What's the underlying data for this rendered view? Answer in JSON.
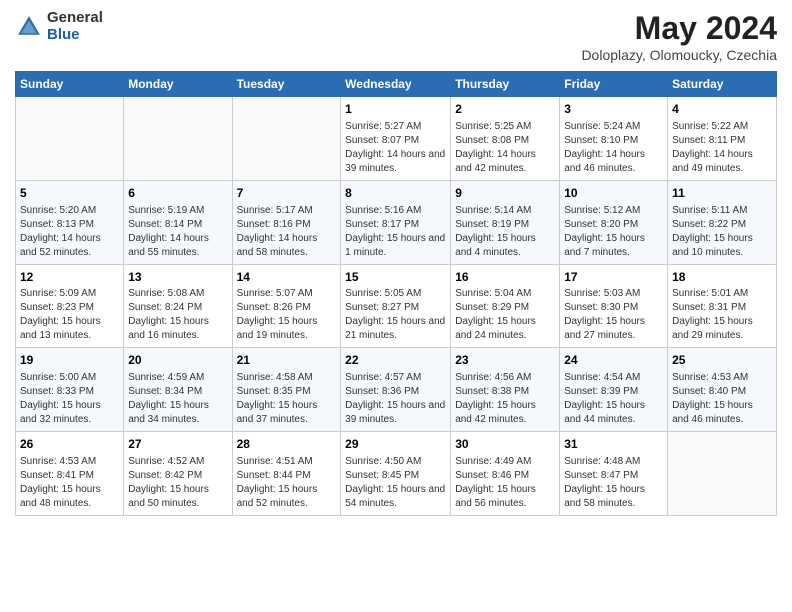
{
  "header": {
    "logo_general": "General",
    "logo_blue": "Blue",
    "month_title": "May 2024",
    "location": "Doloplazy, Olomoucky, Czechia"
  },
  "days_of_week": [
    "Sunday",
    "Monday",
    "Tuesday",
    "Wednesday",
    "Thursday",
    "Friday",
    "Saturday"
  ],
  "weeks": [
    [
      {
        "day": "",
        "info": ""
      },
      {
        "day": "",
        "info": ""
      },
      {
        "day": "",
        "info": ""
      },
      {
        "day": "1",
        "info": "Sunrise: 5:27 AM\nSunset: 8:07 PM\nDaylight: 14 hours and 39 minutes."
      },
      {
        "day": "2",
        "info": "Sunrise: 5:25 AM\nSunset: 8:08 PM\nDaylight: 14 hours and 42 minutes."
      },
      {
        "day": "3",
        "info": "Sunrise: 5:24 AM\nSunset: 8:10 PM\nDaylight: 14 hours and 46 minutes."
      },
      {
        "day": "4",
        "info": "Sunrise: 5:22 AM\nSunset: 8:11 PM\nDaylight: 14 hours and 49 minutes."
      }
    ],
    [
      {
        "day": "5",
        "info": "Sunrise: 5:20 AM\nSunset: 8:13 PM\nDaylight: 14 hours and 52 minutes."
      },
      {
        "day": "6",
        "info": "Sunrise: 5:19 AM\nSunset: 8:14 PM\nDaylight: 14 hours and 55 minutes."
      },
      {
        "day": "7",
        "info": "Sunrise: 5:17 AM\nSunset: 8:16 PM\nDaylight: 14 hours and 58 minutes."
      },
      {
        "day": "8",
        "info": "Sunrise: 5:16 AM\nSunset: 8:17 PM\nDaylight: 15 hours and 1 minute."
      },
      {
        "day": "9",
        "info": "Sunrise: 5:14 AM\nSunset: 8:19 PM\nDaylight: 15 hours and 4 minutes."
      },
      {
        "day": "10",
        "info": "Sunrise: 5:12 AM\nSunset: 8:20 PM\nDaylight: 15 hours and 7 minutes."
      },
      {
        "day": "11",
        "info": "Sunrise: 5:11 AM\nSunset: 8:22 PM\nDaylight: 15 hours and 10 minutes."
      }
    ],
    [
      {
        "day": "12",
        "info": "Sunrise: 5:09 AM\nSunset: 8:23 PM\nDaylight: 15 hours and 13 minutes."
      },
      {
        "day": "13",
        "info": "Sunrise: 5:08 AM\nSunset: 8:24 PM\nDaylight: 15 hours and 16 minutes."
      },
      {
        "day": "14",
        "info": "Sunrise: 5:07 AM\nSunset: 8:26 PM\nDaylight: 15 hours and 19 minutes."
      },
      {
        "day": "15",
        "info": "Sunrise: 5:05 AM\nSunset: 8:27 PM\nDaylight: 15 hours and 21 minutes."
      },
      {
        "day": "16",
        "info": "Sunrise: 5:04 AM\nSunset: 8:29 PM\nDaylight: 15 hours and 24 minutes."
      },
      {
        "day": "17",
        "info": "Sunrise: 5:03 AM\nSunset: 8:30 PM\nDaylight: 15 hours and 27 minutes."
      },
      {
        "day": "18",
        "info": "Sunrise: 5:01 AM\nSunset: 8:31 PM\nDaylight: 15 hours and 29 minutes."
      }
    ],
    [
      {
        "day": "19",
        "info": "Sunrise: 5:00 AM\nSunset: 8:33 PM\nDaylight: 15 hours and 32 minutes."
      },
      {
        "day": "20",
        "info": "Sunrise: 4:59 AM\nSunset: 8:34 PM\nDaylight: 15 hours and 34 minutes."
      },
      {
        "day": "21",
        "info": "Sunrise: 4:58 AM\nSunset: 8:35 PM\nDaylight: 15 hours and 37 minutes."
      },
      {
        "day": "22",
        "info": "Sunrise: 4:57 AM\nSunset: 8:36 PM\nDaylight: 15 hours and 39 minutes."
      },
      {
        "day": "23",
        "info": "Sunrise: 4:56 AM\nSunset: 8:38 PM\nDaylight: 15 hours and 42 minutes."
      },
      {
        "day": "24",
        "info": "Sunrise: 4:54 AM\nSunset: 8:39 PM\nDaylight: 15 hours and 44 minutes."
      },
      {
        "day": "25",
        "info": "Sunrise: 4:53 AM\nSunset: 8:40 PM\nDaylight: 15 hours and 46 minutes."
      }
    ],
    [
      {
        "day": "26",
        "info": "Sunrise: 4:53 AM\nSunset: 8:41 PM\nDaylight: 15 hours and 48 minutes."
      },
      {
        "day": "27",
        "info": "Sunrise: 4:52 AM\nSunset: 8:42 PM\nDaylight: 15 hours and 50 minutes."
      },
      {
        "day": "28",
        "info": "Sunrise: 4:51 AM\nSunset: 8:44 PM\nDaylight: 15 hours and 52 minutes."
      },
      {
        "day": "29",
        "info": "Sunrise: 4:50 AM\nSunset: 8:45 PM\nDaylight: 15 hours and 54 minutes."
      },
      {
        "day": "30",
        "info": "Sunrise: 4:49 AM\nSunset: 8:46 PM\nDaylight: 15 hours and 56 minutes."
      },
      {
        "day": "31",
        "info": "Sunrise: 4:48 AM\nSunset: 8:47 PM\nDaylight: 15 hours and 58 minutes."
      },
      {
        "day": "",
        "info": ""
      }
    ]
  ]
}
